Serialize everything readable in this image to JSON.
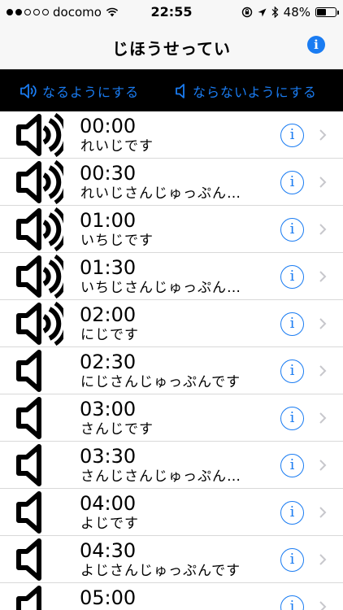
{
  "status_bar": {
    "carrier": "docomo",
    "time": "22:55",
    "battery_percent": "48%",
    "battery_level": 0.48,
    "signal_dots_filled": 2,
    "icons": [
      "wifi-icon",
      "orientation-lock-icon",
      "location-icon",
      "bluetooth-icon",
      "battery-icon"
    ]
  },
  "nav": {
    "title": "じほうせってい",
    "info_glyph": "i"
  },
  "toolbar": {
    "enable_label": "なるようにする",
    "disable_label": "ならないようにする"
  },
  "colors": {
    "accent": "#1a7cf2",
    "toolbar_bg": "#000000",
    "bar_bg": "#f7f7f7"
  },
  "rows": [
    {
      "time": "00:00",
      "label": "れいじです",
      "sound_on": true
    },
    {
      "time": "00:30",
      "label": "れいじさんじゅっぷん…",
      "sound_on": true
    },
    {
      "time": "01:00",
      "label": "いちじです",
      "sound_on": true
    },
    {
      "time": "01:30",
      "label": "いちじさんじゅっぷん…",
      "sound_on": true
    },
    {
      "time": "02:00",
      "label": "にじです",
      "sound_on": true
    },
    {
      "time": "02:30",
      "label": "にじさんじゅっぷんです",
      "sound_on": false
    },
    {
      "time": "03:00",
      "label": "さんじです",
      "sound_on": false
    },
    {
      "time": "03:30",
      "label": "さんじさんじゅっぷん…",
      "sound_on": false
    },
    {
      "time": "04:00",
      "label": "よじです",
      "sound_on": false
    },
    {
      "time": "04:30",
      "label": "よじさんじゅっぷんです",
      "sound_on": false
    },
    {
      "time": "05:00",
      "label": "",
      "sound_on": false
    }
  ]
}
